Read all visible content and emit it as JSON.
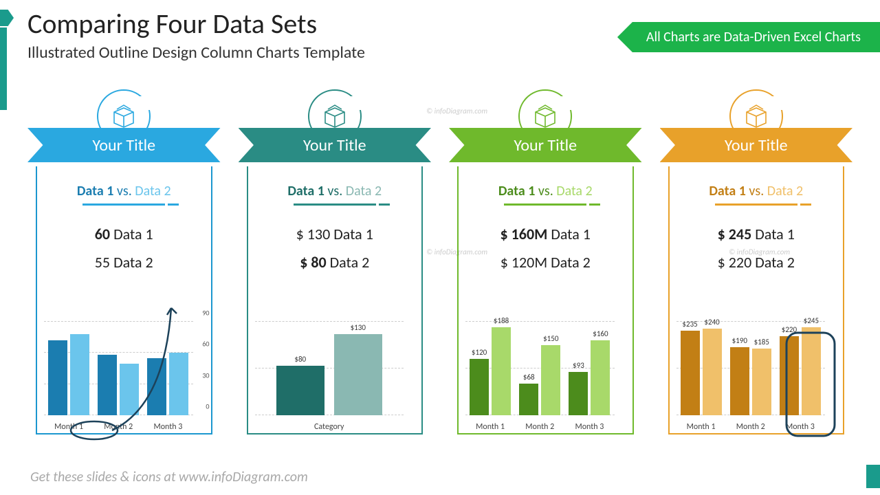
{
  "header": {
    "title": "Comparing Four Data Sets",
    "subtitle": "Illustrated Outline Design Column Charts Template",
    "ribbon": "All Charts are Data-Driven Excel Charts"
  },
  "footer": "Get these slides & icons at www.infoDiagram.com",
  "watermark": "© infoDiagram.com",
  "cards": [
    {
      "ribbon_title": "Your Title",
      "vs_d1": "Data 1",
      "vs_sep": " vs. ",
      "vs_d2": "Data 2",
      "metric1_val": "60",
      "metric1_lbl": " Data 1",
      "metric2_val": "55",
      "metric2_lbl": " Data 2"
    },
    {
      "ribbon_title": "Your Title",
      "vs_d1": "Data 1",
      "vs_sep": " vs. ",
      "vs_d2": "Data 2",
      "metric1_val": "$ 130",
      "metric1_lbl": " Data 1",
      "metric2_val": "$ 80",
      "metric2_lbl": " Data 2"
    },
    {
      "ribbon_title": "Your Title",
      "vs_d1": "Data 1",
      "vs_sep": " vs. ",
      "vs_d2": "Data 2",
      "metric1_val": "$ 160M",
      "metric1_lbl": " Data 1",
      "metric2_val": "$ 120M",
      "metric2_lbl": " Data 2"
    },
    {
      "ribbon_title": "Your Title",
      "vs_d1": "Data 1",
      "vs_sep": " vs. ",
      "vs_d2": "Data 2",
      "metric1_val": "$ 245",
      "metric1_lbl": " Data 1",
      "metric2_val": "$ 220",
      "metric2_lbl": " Data 2"
    }
  ],
  "chart_data": [
    {
      "type": "bar",
      "title": "",
      "xlabel": "",
      "ylabel": "",
      "categories": [
        "Month 1",
        "Month 2",
        "Month 3"
      ],
      "series": [
        {
          "name": "Data 1",
          "values": [
            72,
            58,
            55
          ]
        },
        {
          "name": "Data 2",
          "values": [
            78,
            50,
            60
          ]
        }
      ],
      "ylim": [
        0,
        90
      ],
      "yticks": [
        0,
        30,
        60,
        90
      ],
      "show_value_labels": false
    },
    {
      "type": "bar",
      "title": "",
      "xlabel": "",
      "ylabel": "",
      "categories": [
        "Category"
      ],
      "series": [
        {
          "name": "Data 2",
          "values": [
            80
          ]
        },
        {
          "name": "Data 1",
          "values": [
            130
          ]
        }
      ],
      "ylim": [
        0,
        150
      ],
      "value_labels": [
        [
          "$80"
        ],
        [
          "$130"
        ]
      ]
    },
    {
      "type": "bar",
      "title": "",
      "xlabel": "",
      "ylabel": "",
      "categories": [
        "Month 1",
        "Month 2",
        "Month 3"
      ],
      "series": [
        {
          "name": "Data 1",
          "values": [
            120,
            68,
            93
          ]
        },
        {
          "name": "Data 2",
          "values": [
            188,
            150,
            160
          ]
        }
      ],
      "ylim": [
        0,
        200
      ],
      "value_labels": [
        [
          "$120",
          "$68",
          "$93"
        ],
        [
          "$188",
          "$150",
          "$160"
        ]
      ]
    },
    {
      "type": "bar",
      "title": "",
      "xlabel": "",
      "ylabel": "",
      "categories": [
        "Month 1",
        "Month 2",
        "Month 3"
      ],
      "series": [
        {
          "name": "Data 1",
          "values": [
            235,
            190,
            220
          ]
        },
        {
          "name": "Data 2",
          "values": [
            240,
            185,
            245
          ]
        }
      ],
      "ylim": [
        0,
        260
      ],
      "value_labels": [
        [
          "$235",
          "$190",
          "$220"
        ],
        [
          "$240",
          "$185",
          "$245"
        ]
      ]
    }
  ]
}
